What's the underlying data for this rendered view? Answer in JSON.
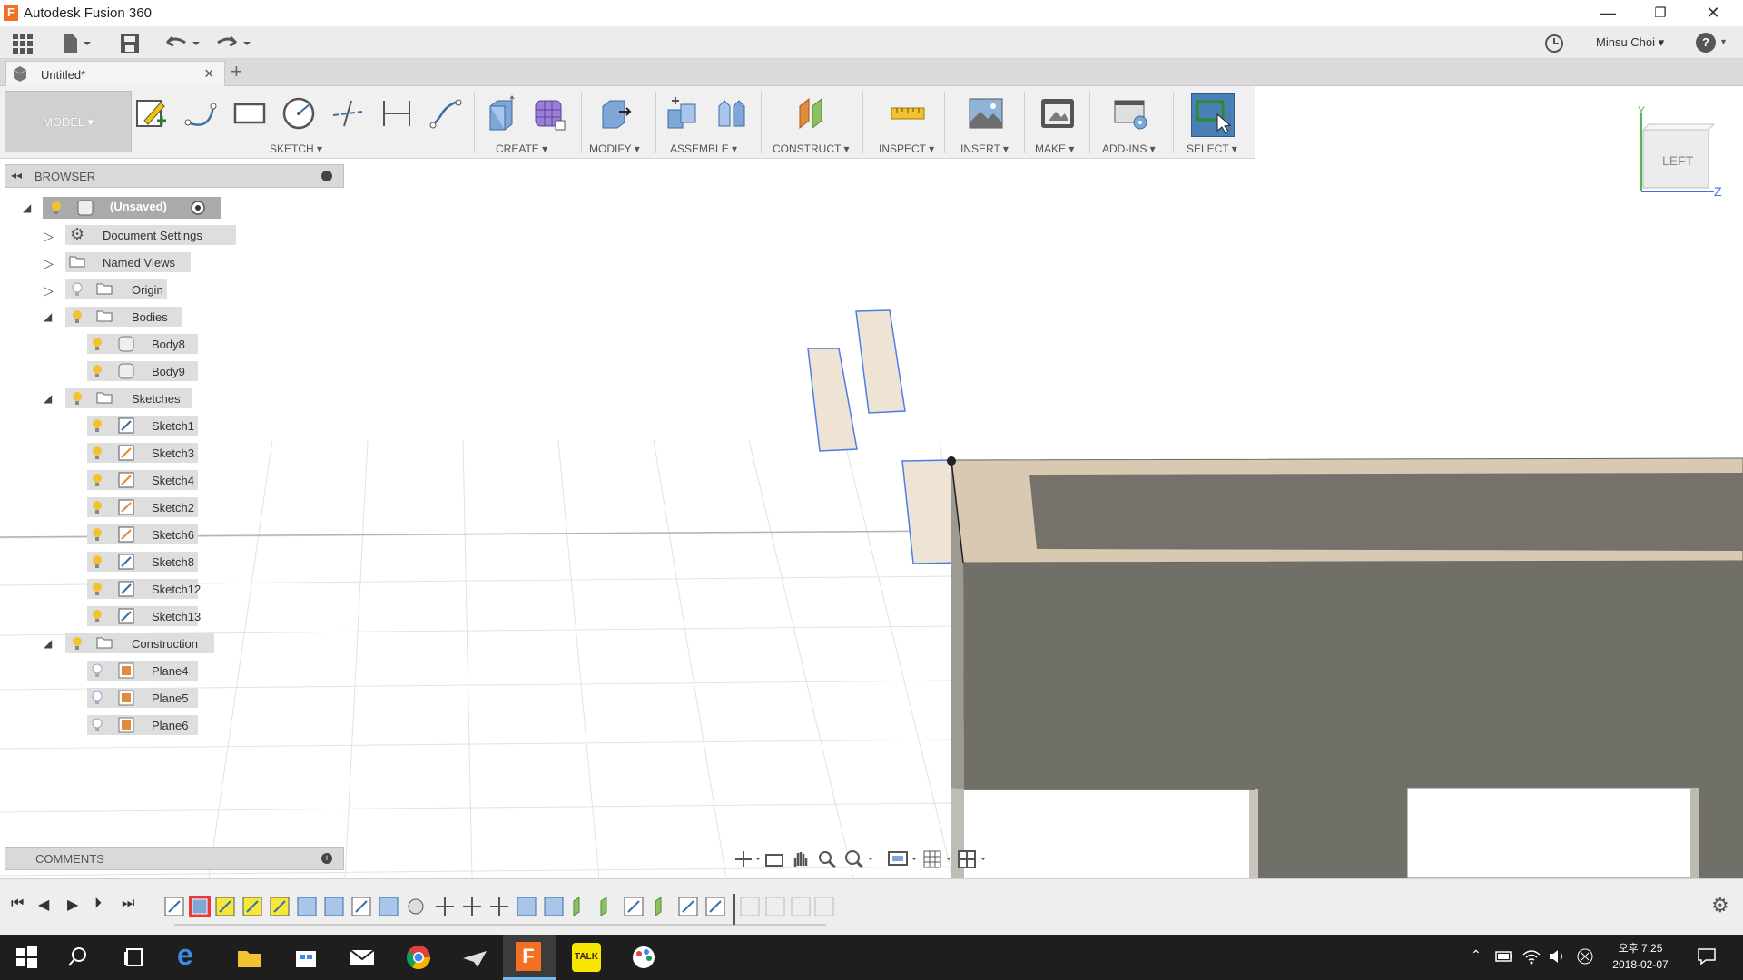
{
  "window": {
    "title": "Autodesk Fusion 360",
    "app_icon_letter": "F",
    "minimize": "—",
    "restore": "❐",
    "close": "✕"
  },
  "quick_access": {
    "user_name": "Minsu Choi ▾",
    "help": "?"
  },
  "tabs": {
    "doc_tab_label": "Untitled*",
    "close": "×",
    "new_tab": "+"
  },
  "toolbar": {
    "workspace": "MODEL ▾",
    "groups": {
      "sketch": "SKETCH ▾",
      "create": "CREATE ▾",
      "modify": "MODIFY ▾",
      "assemble": "ASSEMBLE ▾",
      "construct": "CONSTRUCT ▾",
      "inspect": "INSPECT ▾",
      "insert": "INSERT ▾",
      "make": "MAKE ▾",
      "addins": "ADD-INS ▾",
      "select": "SELECT ▾"
    }
  },
  "viewcube": {
    "face": "LEFT",
    "axis_y": "Y",
    "axis_z": "Z"
  },
  "browser": {
    "title": "BROWSER",
    "root": "(Unsaved)",
    "items": {
      "document_settings": "Document Settings",
      "named_views": "Named Views",
      "origin": "Origin",
      "bodies": "Bodies",
      "body8": "Body8",
      "body9": "Body9",
      "sketches": "Sketches",
      "sketch1": "Sketch1",
      "sketch3": "Sketch3",
      "sketch4": "Sketch4",
      "sketch2": "Sketch2",
      "sketch6": "Sketch6",
      "sketch8": "Sketch8",
      "sketch12": "Sketch12",
      "sketch13": "Sketch13",
      "construction": "Construction",
      "plane4": "Plane4",
      "plane5": "Plane5",
      "plane6": "Plane6"
    }
  },
  "comments": {
    "title": "COMMENTS"
  },
  "taskbar": {
    "ampm": "오후 7:25",
    "date": "2018-02-07"
  },
  "colors": {
    "accent": "#3a6ea5",
    "body_face": "#6f6f6a",
    "body_top": "#d9c9b3",
    "sketch_fill": "#efe3d3",
    "sketch_line": "#4a7ee8",
    "select_btn": "#4a7fb5"
  }
}
